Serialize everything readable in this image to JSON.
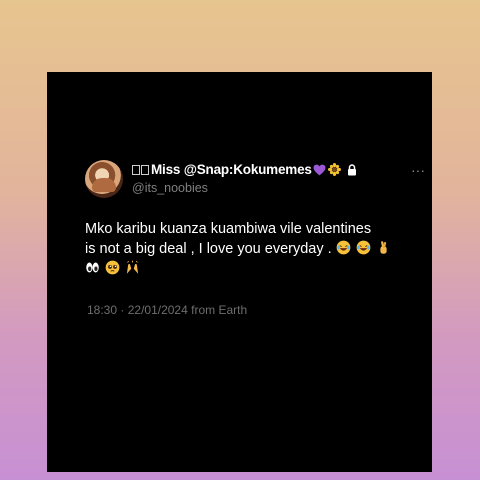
{
  "tweet": {
    "display_name": "Miss @Snap:Kokumemes",
    "handle": "@its_noobies",
    "text_line1": "Mko karibu kuanza kuambiwa vile valentines",
    "text_line2": "is not a big deal , I love you everyday .",
    "emoji_line2": [
      "laughing-crying-emoji",
      "laughing-crying-emoji",
      "crossed-fingers-emoji"
    ],
    "emoji_line3": [
      "eyes-emoji",
      "pleading-face-emoji",
      "raised-hands-emoji"
    ],
    "time": "18:30",
    "date": "22/01/2024",
    "source": "from Earth",
    "more_glyph": "···"
  },
  "colors": {
    "card_bg": "#000000",
    "text": "#ffffff",
    "muted": "#7f7f7f",
    "heart": "#9b59d6"
  }
}
